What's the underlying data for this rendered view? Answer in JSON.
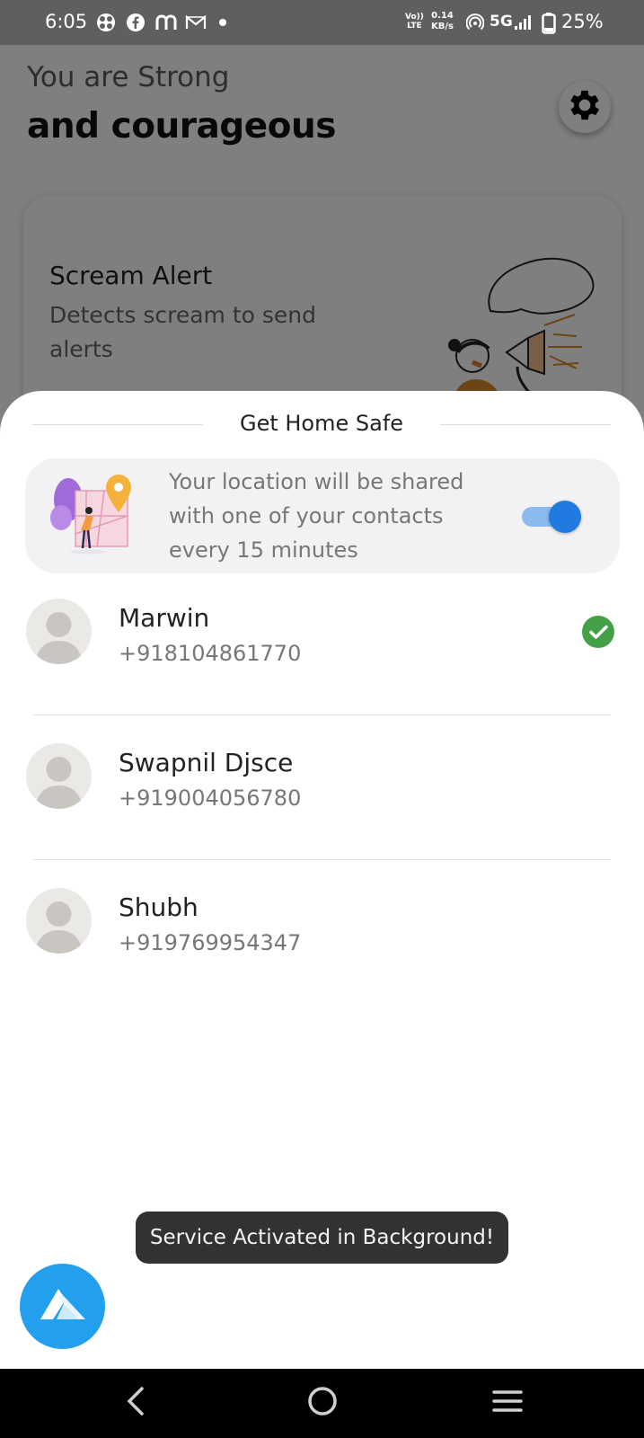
{
  "status_bar": {
    "time": "6:05",
    "app_icons": [
      "pinwheel-icon",
      "facebook-icon",
      "m-icon",
      "gmail-icon"
    ],
    "volte_line1": "Vo))",
    "volte_line2": "LTE",
    "speed_value": "0.14",
    "speed_unit": "KB/s",
    "network": "5G",
    "battery": "25%"
  },
  "header": {
    "greeting_line1": "You are Strong",
    "greeting_line2": "and courageous",
    "settings_icon": "gear-icon"
  },
  "scream_card": {
    "title": "Scream Alert",
    "description": "Detects scream to send alerts"
  },
  "sheet": {
    "title": "Get Home Safe",
    "share_text": "Your location will be shared with one of your contacts every 15 minutes",
    "toggle_on": true,
    "accent_color": "#1f7be0"
  },
  "contacts": [
    {
      "name": "Marwin",
      "phone": "+918104861770",
      "selected": true
    },
    {
      "name": "Swapnil Djsce",
      "phone": "+919004056780",
      "selected": false
    },
    {
      "name": "Shubh",
      "phone": "+919769954347",
      "selected": false
    }
  ],
  "toast": {
    "message": "Service Activated in Background!"
  },
  "fab": {
    "icon": "app-logo-icon",
    "color": "#22a0ee"
  },
  "nav_bar": {
    "back": "back-icon",
    "home": "home-icon",
    "menu": "menu-icon"
  },
  "colors": {
    "check_green": "#43a047"
  }
}
